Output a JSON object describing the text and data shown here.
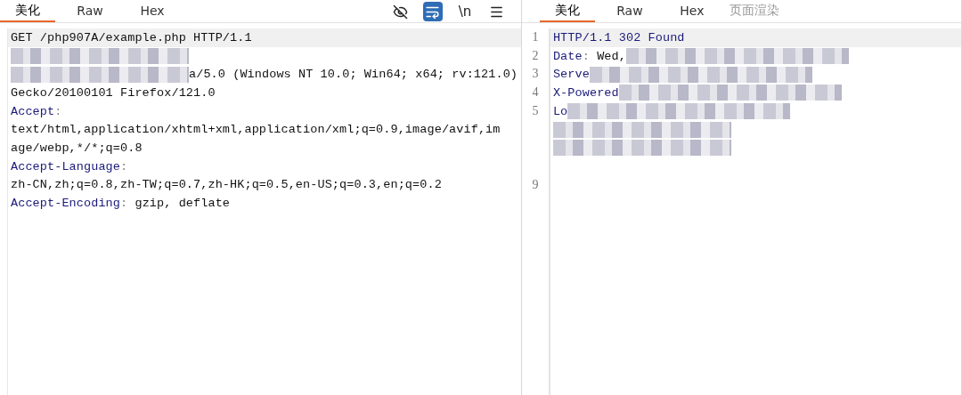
{
  "request": {
    "tabs": [
      {
        "label": "美化",
        "selected": true
      },
      {
        "label": "Raw",
        "selected": false
      },
      {
        "label": "Hex",
        "selected": false
      }
    ],
    "toolbar": [
      {
        "kind": "hide",
        "on": false
      },
      {
        "kind": "wrap",
        "on": true
      },
      {
        "kind": "newline",
        "text": "\\n",
        "on": false
      },
      {
        "kind": "menu",
        "on": false
      }
    ],
    "lines": [
      {
        "highlighted": true,
        "parts": [
          {
            "kind": "text",
            "text": "GET /php907A/example.php HTTP/1.1"
          }
        ]
      },
      {
        "highlighted": false,
        "parts": [
          {
            "kind": "redacted"
          }
        ]
      },
      {
        "highlighted": false,
        "parts": [
          {
            "kind": "redacted"
          },
          {
            "kind": "text",
            "text": "a/5.0 (Windows NT 10.0; Win64; x64; rv:121.0)"
          }
        ]
      },
      {
        "highlighted": false,
        "parts": [
          {
            "kind": "text",
            "text": "Gecko/20100101 Firefox/121.0"
          }
        ]
      },
      {
        "highlighted": false,
        "parts": [
          {
            "kind": "key",
            "text": "Accept"
          },
          {
            "kind": "sep",
            "text": ":"
          }
        ]
      },
      {
        "highlighted": false,
        "parts": [
          {
            "kind": "text",
            "text": "text/html,application/xhtml+xml,application/xml;q=0.9,image/avif,im"
          }
        ]
      },
      {
        "highlighted": false,
        "parts": [
          {
            "kind": "text",
            "text": "age/webp,*/*;q=0.8"
          }
        ]
      },
      {
        "highlighted": false,
        "parts": [
          {
            "kind": "key",
            "text": "Accept-Language"
          },
          {
            "kind": "sep",
            "text": ":"
          }
        ]
      },
      {
        "highlighted": false,
        "parts": [
          {
            "kind": "text",
            "text": "zh-CN,zh;q=0.8,zh-TW;q=0.7,zh-HK;q=0.5,en-US;q=0.3,en;q=0.2"
          }
        ]
      },
      {
        "highlighted": false,
        "parts": [
          {
            "kind": "key",
            "text": "Accept-Encoding"
          },
          {
            "kind": "sep",
            "text": ":"
          },
          {
            "kind": "text",
            "text": " gzip, deflate"
          }
        ]
      }
    ]
  },
  "response": {
    "tabs": [
      {
        "label": "美化",
        "selected": true
      },
      {
        "label": "Raw",
        "selected": false
      },
      {
        "label": "Hex",
        "selected": false
      },
      {
        "label": "页面渲染",
        "selected": false,
        "disabled": true
      }
    ],
    "lines": [
      {
        "number": "1",
        "highlighted": true,
        "parts": [
          {
            "kind": "key",
            "text": "HTTP/1.1 302 Found"
          }
        ]
      },
      {
        "number": "2",
        "highlighted": false,
        "parts": [
          {
            "kind": "key",
            "text": "Date"
          },
          {
            "kind": "sep",
            "text": ":"
          },
          {
            "kind": "text",
            "text": " Wed,"
          },
          {
            "kind": "redacted"
          }
        ]
      },
      {
        "number": "3",
        "highlighted": false,
        "parts": [
          {
            "kind": "key",
            "text": "Serve"
          },
          {
            "kind": "redacted"
          }
        ]
      },
      {
        "number": "4",
        "highlighted": false,
        "parts": [
          {
            "kind": "key",
            "text": "X-Powered"
          },
          {
            "kind": "redacted"
          }
        ]
      },
      {
        "number": "5",
        "highlighted": false,
        "parts": [
          {
            "kind": "key",
            "text": "Lo"
          },
          {
            "kind": "redacted"
          }
        ]
      },
      {
        "highlighted": false,
        "parts": [
          {
            "kind": "redacted"
          }
        ]
      },
      {
        "highlighted": false,
        "parts": [
          {
            "kind": "redacted"
          }
        ]
      },
      {
        "highlighted": false
      },
      {
        "number": "9",
        "highlighted": false
      }
    ]
  }
}
